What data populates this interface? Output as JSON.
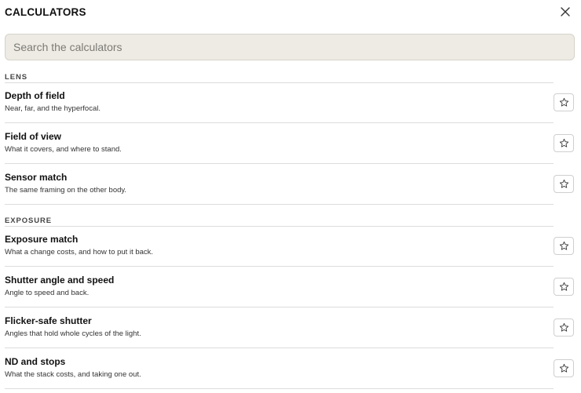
{
  "header": {
    "title": "CALCULATORS",
    "close_icon": "close-icon"
  },
  "search": {
    "placeholder": "Search the calculators",
    "value": ""
  },
  "sections": [
    {
      "label": "LENS",
      "items": [
        {
          "title": "Depth of field",
          "description": "Near, far, and the hyperfocal.",
          "favorite_icon": "star-icon"
        },
        {
          "title": "Field of view",
          "description": "What it covers, and where to stand.",
          "favorite_icon": "star-icon"
        },
        {
          "title": "Sensor match",
          "description": "The same framing on the other body.",
          "favorite_icon": "star-icon"
        }
      ]
    },
    {
      "label": "EXPOSURE",
      "items": [
        {
          "title": "Exposure match",
          "description": "What a change costs, and how to put it back.",
          "favorite_icon": "star-icon"
        },
        {
          "title": "Shutter angle and speed",
          "description": "Angle to speed and back.",
          "favorite_icon": "star-icon"
        },
        {
          "title": "Flicker-safe shutter",
          "description": "Angles that hold whole cycles of the light.",
          "favorite_icon": "star-icon"
        },
        {
          "title": "ND and stops",
          "description": "What the stack costs, and taking one out.",
          "favorite_icon": "star-icon"
        }
      ]
    }
  ]
}
